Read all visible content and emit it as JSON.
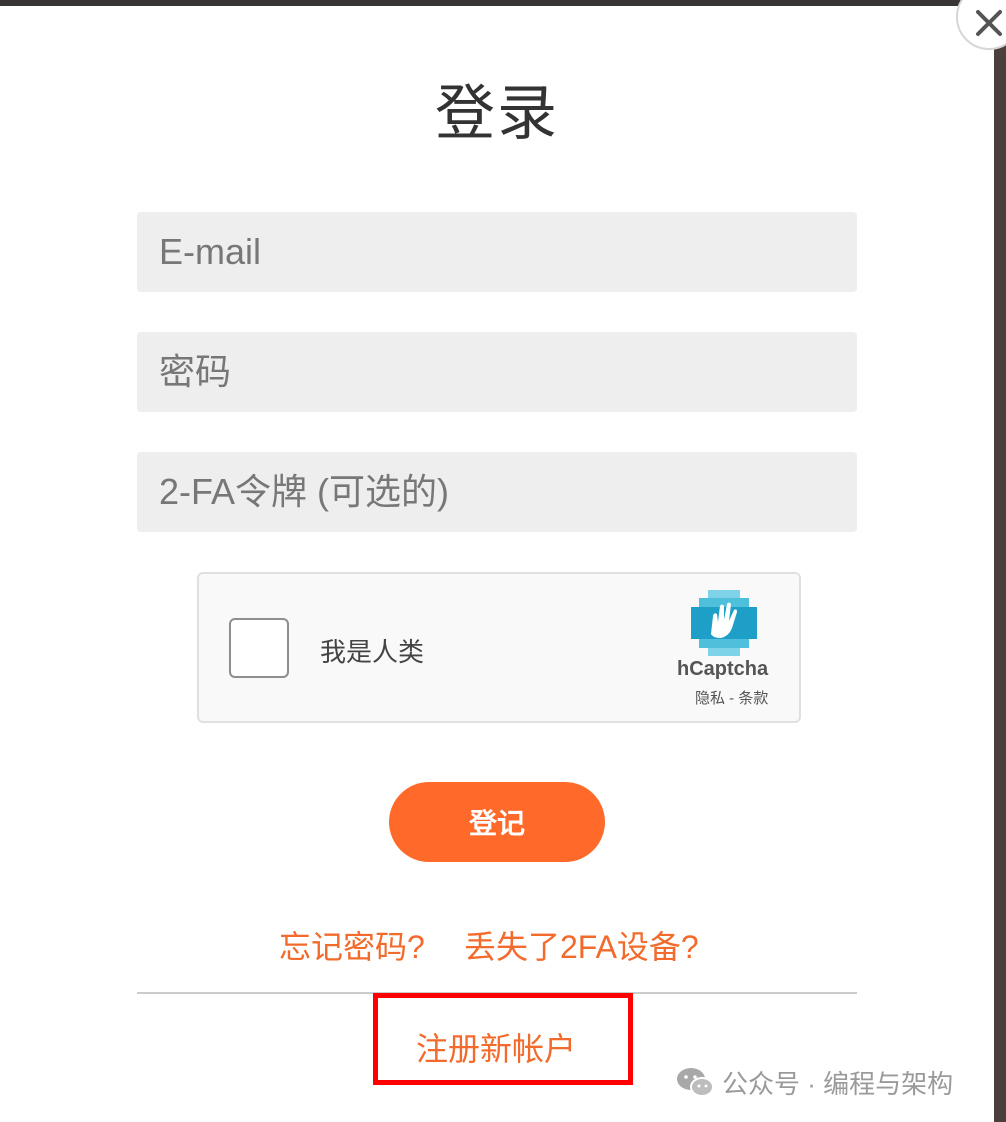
{
  "modal": {
    "title": "登录",
    "close_label": "×"
  },
  "form": {
    "email_placeholder": "E-mail",
    "password_placeholder": "密码",
    "twofa_placeholder": "2-FA令牌 (可选的)"
  },
  "captcha": {
    "label": "我是人类",
    "brand": "hCaptcha",
    "privacy": "隐私",
    "separator": " - ",
    "terms": "条款"
  },
  "actions": {
    "login_label": "登记",
    "forgot_password": "忘记密码?",
    "lost_2fa": "丢失了2FA设备?",
    "register": "注册新帐户"
  },
  "watermark": {
    "text": "公众号 · 编程与架构"
  },
  "colors": {
    "accent": "#ff6a2b",
    "link": "#f26b2c",
    "highlight": "#ff0000",
    "field_bg": "#eeeeee"
  }
}
